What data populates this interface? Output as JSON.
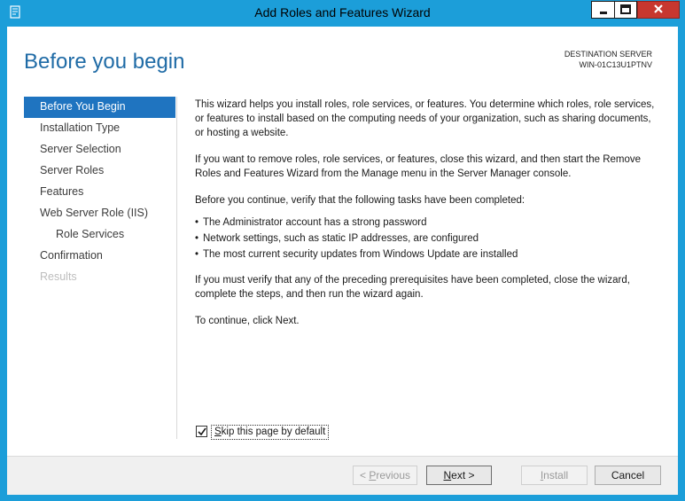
{
  "window": {
    "title": "Add Roles and Features Wizard"
  },
  "header": {
    "page_title": "Before you begin",
    "destination_label": "DESTINATION SERVER",
    "destination_value": "WIN-01C13U1PTNV"
  },
  "nav": {
    "items": [
      {
        "label": "Before You Begin",
        "state": "active"
      },
      {
        "label": "Installation Type",
        "state": "normal"
      },
      {
        "label": "Server Selection",
        "state": "normal"
      },
      {
        "label": "Server Roles",
        "state": "normal"
      },
      {
        "label": "Features",
        "state": "normal"
      },
      {
        "label": "Web Server Role (IIS)",
        "state": "normal"
      },
      {
        "label": "Role Services",
        "state": "sub"
      },
      {
        "label": "Confirmation",
        "state": "normal"
      },
      {
        "label": "Results",
        "state": "disabled"
      }
    ]
  },
  "content": {
    "p1": "This wizard helps you install roles, role services, or features. You determine which roles, role services, or features to install based on the computing needs of your organization, such as sharing documents, or hosting a website.",
    "p2": "If you want to remove roles, role services, or features, close this wizard, and then start the Remove Roles and Features Wizard from the Manage menu in the Server Manager console.",
    "p3": "Before you continue, verify that the following tasks have been completed:",
    "bullets": [
      "The Administrator account has a strong password",
      "Network settings, such as static IP addresses, are configured",
      "The most current security updates from Windows Update are installed"
    ],
    "p4": "If you must verify that any of the preceding prerequisites have been completed, close the wizard, complete the steps, and then run the wizard again.",
    "p5": "To continue, click Next."
  },
  "skip": {
    "label": "Skip this page by default",
    "checked": true
  },
  "buttons": {
    "previous": "< Previous",
    "next": "Next >",
    "install": "Install",
    "cancel": "Cancel"
  },
  "colors": {
    "titlebar": "#1c9ed9",
    "accent": "#1f6ba6",
    "nav_active": "#1f74c0",
    "close": "#c7372f"
  }
}
